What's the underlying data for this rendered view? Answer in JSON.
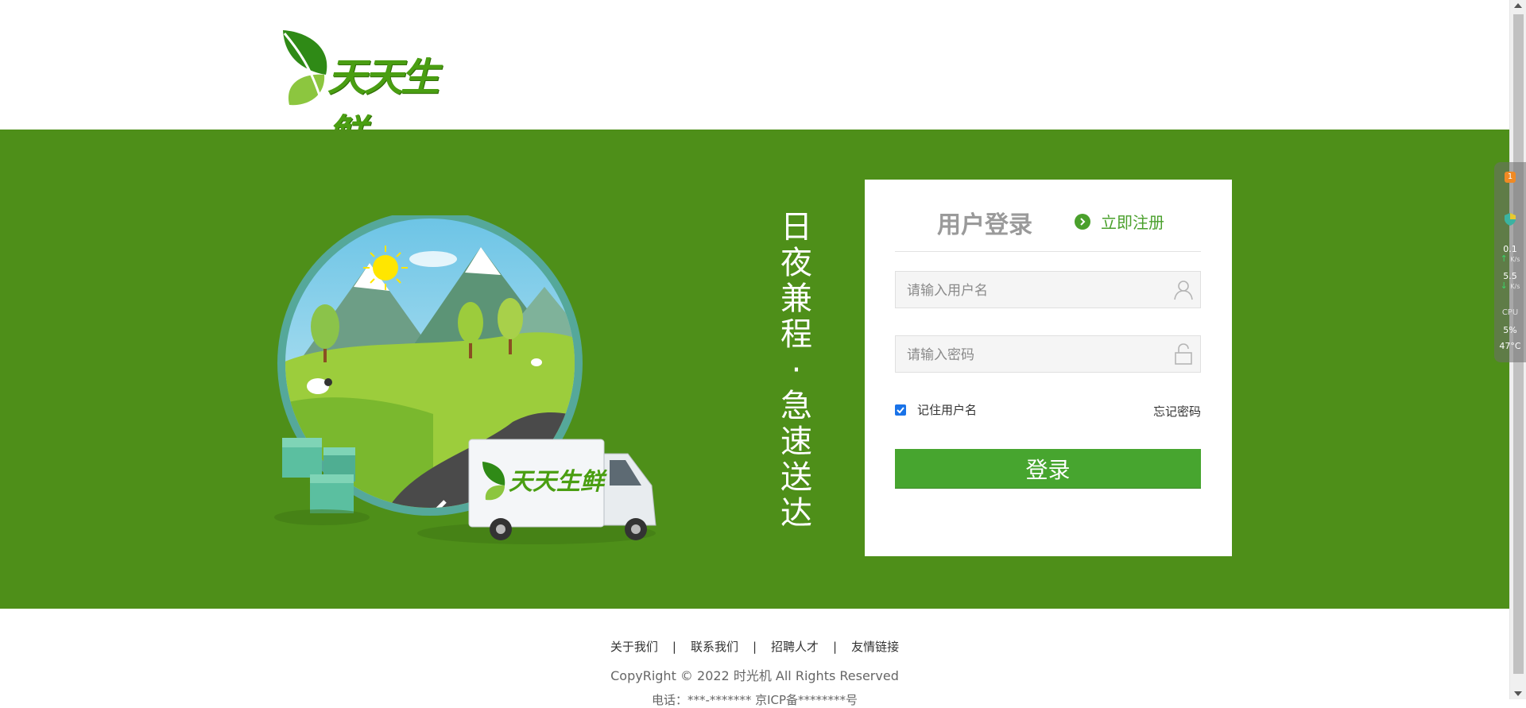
{
  "header": {
    "logo_text": "天天生鲜"
  },
  "banner": {
    "truck_logo_text": "天天生鲜",
    "slogan": [
      "日",
      "夜",
      "兼",
      "程",
      "·",
      "急",
      "速",
      "送",
      "达"
    ]
  },
  "login": {
    "title": "用户登录",
    "register_label": "立即注册",
    "username_placeholder": "请输入用户名",
    "password_placeholder": "请输入密码",
    "remember_label": "记住用户名",
    "remember_checked": true,
    "forgot_label": "忘记密码",
    "submit_label": "登录"
  },
  "footer": {
    "links": [
      "关于我们",
      "联系我们",
      "招聘人才",
      "友情链接"
    ],
    "separator": "|",
    "copyright": "CopyRight © 2022 时光机 All Rights Reserved",
    "tel": "电话：***-******* 京ICP备********号"
  },
  "monitor": {
    "badge": "1",
    "up_speed": "0.1",
    "up_unit": "K/s",
    "down_speed": "5.5",
    "down_unit": "K/s",
    "cpu_label": "CPU",
    "cpu_usage": "5%",
    "temperature": "47°C"
  },
  "colors": {
    "banner_green": "#4e8f19",
    "button_green": "#47a52f",
    "accent_green": "#4aa02c"
  }
}
